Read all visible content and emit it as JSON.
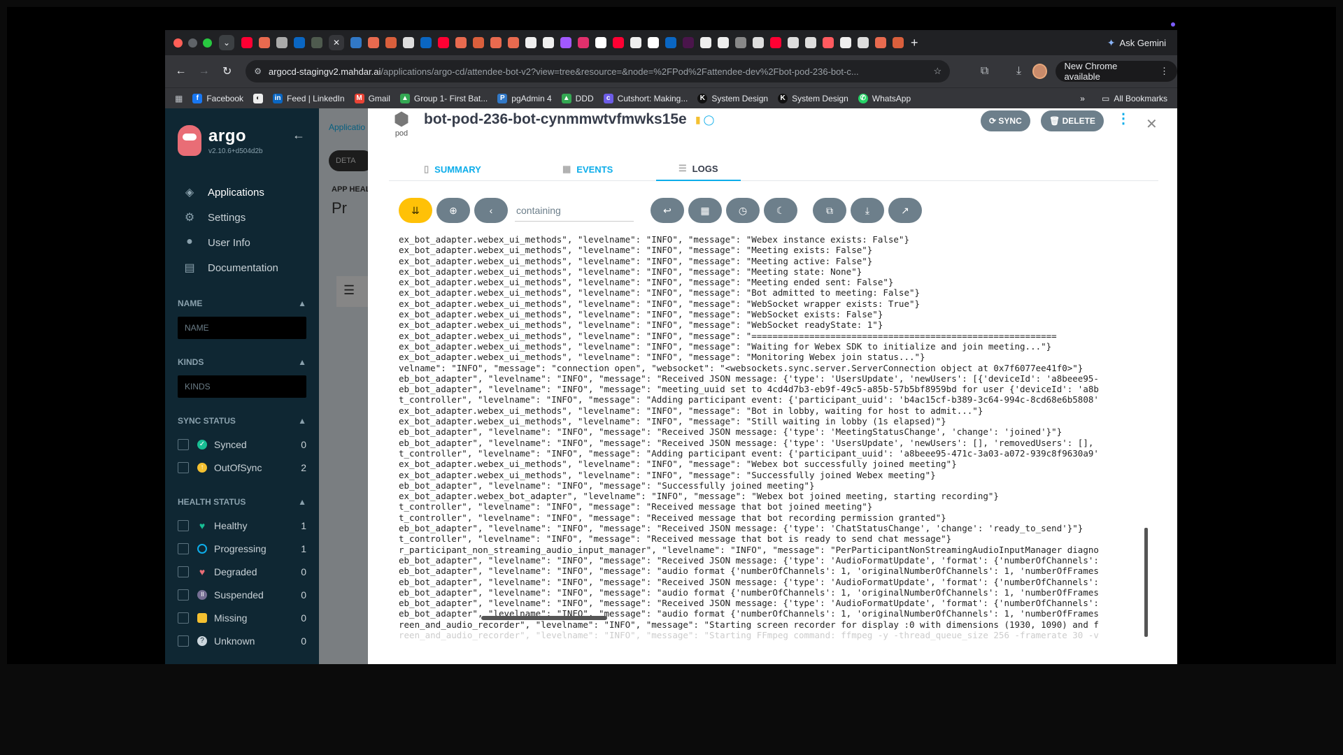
{
  "browser": {
    "ask_gemini": "Ask Gemini",
    "url_host": "argocd-stagingv2.mahdar.ai",
    "url_path": "/applications/argo-cd/attendee-bot-v2?view=tree&resource=&node=%2FPod%2Fattendee-dev%2Fbot-pod-236-bot-c...",
    "update_chip": "New Chrome available",
    "bookmarks": [
      "Facebook",
      "",
      "Feed | LinkedIn",
      "Gmail",
      "Group 1- First Bat...",
      "pgAdmin 4",
      "DDD",
      "Cutshort: Making...",
      "System Design",
      "System Design",
      "WhatsApp"
    ],
    "all_bookmarks": "All Bookmarks",
    "more": "»"
  },
  "sidebar": {
    "brand": "argo",
    "version": "v2.10.6+d504d2b",
    "nav": [
      {
        "label": "Applications",
        "icon": "layers-icon"
      },
      {
        "label": "Settings",
        "icon": "gears-icon"
      },
      {
        "label": "User Info",
        "icon": "user-circle-icon"
      },
      {
        "label": "Documentation",
        "icon": "book-icon"
      }
    ],
    "name_title": "NAME",
    "name_placeholder": "NAME",
    "kinds_title": "KINDS",
    "kinds_placeholder": "KINDS",
    "sync_title": "SYNC STATUS",
    "sync_items": [
      {
        "label": "Synced",
        "count": "0",
        "color": "#18be94"
      },
      {
        "label": "OutOfSync",
        "count": "2",
        "color": "#f4c030"
      }
    ],
    "health_title": "HEALTH STATUS",
    "health_items": [
      {
        "label": "Healthy",
        "count": "1",
        "color": "#18be94"
      },
      {
        "label": "Progressing",
        "count": "1",
        "color": "#0dadea"
      },
      {
        "label": "Degraded",
        "count": "0",
        "color": "#e96d76"
      },
      {
        "label": "Suspended",
        "count": "0",
        "color": "#766f94"
      },
      {
        "label": "Missing",
        "count": "0",
        "color": "#f4c030"
      },
      {
        "label": "Unknown",
        "count": "0",
        "color": "#ccd6dd"
      }
    ]
  },
  "background": {
    "breadcrumb": "Applicatio",
    "details_pill": "DETA",
    "app_health": "APP HEAL",
    "progressing": "Pr"
  },
  "panel": {
    "kind": "pod",
    "title": "bot-pod-236-bot-cynmmwtvfmwks15e",
    "sync_label": "SYNC",
    "delete_label": "DELETE",
    "tabs": [
      "SUMMARY",
      "EVENTS",
      "LOGS"
    ],
    "filter_placeholder": "containing",
    "log_lines": [
      "ex_bot_adapter.webex_ui_methods\", \"levelname\": \"INFO\", \"message\": \"Webex instance exists: False\"}",
      "ex_bot_adapter.webex_ui_methods\", \"levelname\": \"INFO\", \"message\": \"Meeting exists: False\"}",
      "ex_bot_adapter.webex_ui_methods\", \"levelname\": \"INFO\", \"message\": \"Meeting active: False\"}",
      "ex_bot_adapter.webex_ui_methods\", \"levelname\": \"INFO\", \"message\": \"Meeting state: None\"}",
      "ex_bot_adapter.webex_ui_methods\", \"levelname\": \"INFO\", \"message\": \"Meeting ended sent: False\"}",
      "ex_bot_adapter.webex_ui_methods\", \"levelname\": \"INFO\", \"message\": \"Bot admitted to meeting: False\"}",
      "ex_bot_adapter.webex_ui_methods\", \"levelname\": \"INFO\", \"message\": \"WebSocket wrapper exists: True\"}",
      "ex_bot_adapter.webex_ui_methods\", \"levelname\": \"INFO\", \"message\": \"WebSocket exists: False\"}",
      "ex_bot_adapter.webex_ui_methods\", \"levelname\": \"INFO\", \"message\": \"WebSocket readyState: 1\"}",
      "ex_bot_adapter.webex_ui_methods\", \"levelname\": \"INFO\", \"message\": \"==========================================================",
      "ex_bot_adapter.webex_ui_methods\", \"levelname\": \"INFO\", \"message\": \"Waiting for Webex SDK to initialize and join meeting...\"}",
      "ex_bot_adapter.webex_ui_methods\", \"levelname\": \"INFO\", \"message\": \"Monitoring Webex join status...\"}",
      "velname\": \"INFO\", \"message\": \"connection open\", \"websocket\": \"<websockets.sync.server.ServerConnection object at 0x7f6077ee41f0>\"}",
      "eb_bot_adapter\", \"levelname\": \"INFO\", \"message\": \"Received JSON message: {'type': 'UsersUpdate', 'newUsers': [{'deviceId': 'a8beee95-",
      "eb_bot_adapter\", \"levelname\": \"INFO\", \"message\": \"meeting_uuid set to 4cd4d7b3-eb9f-49c5-a85b-57b5bf8959bd for user {'deviceId': 'a8b",
      "t_controller\", \"levelname\": \"INFO\", \"message\": \"Adding participant event: {'participant_uuid': 'b4ac15cf-b389-3c64-994c-8cd68e6b5808'",
      "ex_bot_adapter.webex_ui_methods\", \"levelname\": \"INFO\", \"message\": \"Bot in lobby, waiting for host to admit...\"}",
      "ex_bot_adapter.webex_ui_methods\", \"levelname\": \"INFO\", \"message\": \"Still waiting in lobby (1s elapsed)\"}",
      "eb_bot_adapter\", \"levelname\": \"INFO\", \"message\": \"Received JSON message: {'type': 'MeetingStatusChange', 'change': 'joined'}\"}",
      "eb_bot_adapter\", \"levelname\": \"INFO\", \"message\": \"Received JSON message: {'type': 'UsersUpdate', 'newUsers': [], 'removedUsers': [],",
      "t_controller\", \"levelname\": \"INFO\", \"message\": \"Adding participant event: {'participant_uuid': 'a8beee95-471c-3a03-a072-939c8f9630a9'",
      "ex_bot_adapter.webex_ui_methods\", \"levelname\": \"INFO\", \"message\": \"Webex bot successfully joined meeting\"}",
      "ex_bot_adapter.webex_ui_methods\", \"levelname\": \"INFO\", \"message\": \"Successfully joined Webex meeting\"}",
      "eb_bot_adapter\", \"levelname\": \"INFO\", \"message\": \"Successfully joined meeting\"}",
      "ex_bot_adapter.webex_bot_adapter\", \"levelname\": \"INFO\", \"message\": \"Webex bot joined meeting, starting recording\"}",
      "t_controller\", \"levelname\": \"INFO\", \"message\": \"Received message that bot joined meeting\"}",
      "t_controller\", \"levelname\": \"INFO\", \"message\": \"Received message that bot recording permission granted\"}",
      "eb_bot_adapter\", \"levelname\": \"INFO\", \"message\": \"Received JSON message: {'type': 'ChatStatusChange', 'change': 'ready_to_send'}\"}",
      "t_controller\", \"levelname\": \"INFO\", \"message\": \"Received message that bot is ready to send chat message\"}",
      "r_participant_non_streaming_audio_input_manager\", \"levelname\": \"INFO\", \"message\": \"PerParticipantNonStreamingAudioInputManager diagno",
      "eb_bot_adapter\", \"levelname\": \"INFO\", \"message\": \"Received JSON message: {'type': 'AudioFormatUpdate', 'format': {'numberOfChannels':",
      "eb_bot_adapter\", \"levelname\": \"INFO\", \"message\": \"audio format {'numberOfChannels': 1, 'originalNumberOfChannels': 1, 'numberOfFrames",
      "eb_bot_adapter\", \"levelname\": \"INFO\", \"message\": \"Received JSON message: {'type': 'AudioFormatUpdate', 'format': {'numberOfChannels':",
      "eb_bot_adapter\", \"levelname\": \"INFO\", \"message\": \"audio format {'numberOfChannels': 1, 'originalNumberOfChannels': 1, 'numberOfFrames",
      "eb_bot_adapter\", \"levelname\": \"INFO\", \"message\": \"Received JSON message: {'type': 'AudioFormatUpdate', 'format': {'numberOfChannels':",
      "eb_bot_adapter\", \"levelname\": \"INFO\", \"message\": \"audio format {'numberOfChannels': 1, 'originalNumberOfChannels': 1, 'numberOfFrames",
      "reen_and_audio_recorder\", \"levelname\": \"INFO\", \"message\": \"Starting screen recorder for display :0 with dimensions (1930, 1090) and f",
      "reen_and_audio_recorder\", \"levelname\": \"INFO\", \"message\": \"Starting FFmpeg command: ffmpeg -y -thread_queue_size 256 -framerate 30 -v"
    ]
  }
}
